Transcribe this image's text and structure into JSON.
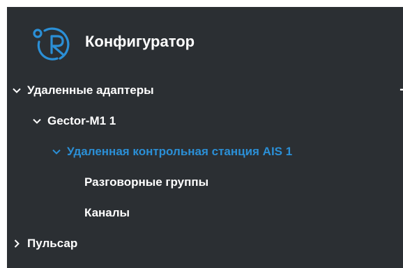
{
  "header": {
    "title": "Конфигуратор",
    "logo_icon": "logo-r-icon"
  },
  "colors": {
    "background": "#2b2f33",
    "text": "#ffffff",
    "accent": "#2b8fd6"
  },
  "tree": {
    "items": [
      {
        "label": "Удаленные адаптеры",
        "expanded": true,
        "action": "+"
      },
      {
        "label": "Gector-M1 1",
        "expanded": true,
        "action": "−"
      },
      {
        "label": "Удаленная контрольная станция AIS 1",
        "expanded": true,
        "selected": true,
        "action": "−"
      },
      {
        "label": "Разговорные группы"
      },
      {
        "label": "Каналы"
      },
      {
        "label": "Пульсар",
        "expanded": false
      }
    ]
  }
}
